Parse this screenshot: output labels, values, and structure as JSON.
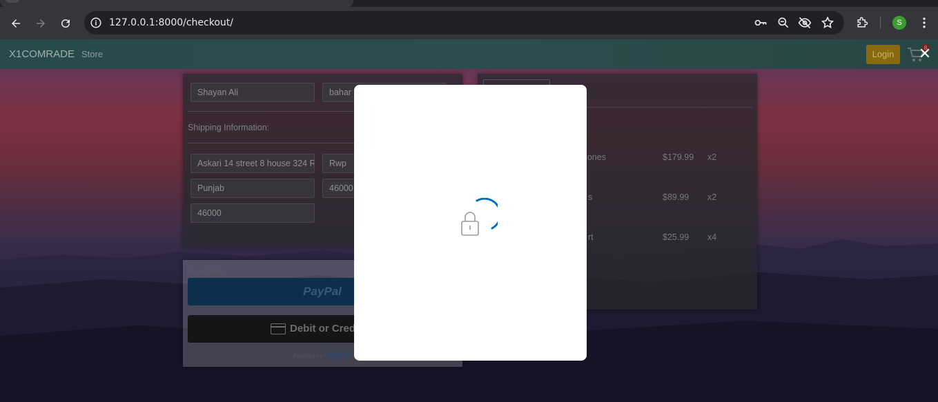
{
  "browser": {
    "url": "127.0.0.1:8000/checkout/",
    "profile_initial": "S",
    "icons": [
      "back-icon",
      "forward-icon",
      "reload-icon",
      "info-icon",
      "key-icon",
      "zoom-icon",
      "eye-off-icon",
      "star-icon",
      "extensions-icon",
      "menu-icon"
    ]
  },
  "navbar": {
    "brand": "X1COMRADE",
    "store_link": "Store",
    "login_label": "Login",
    "cart_count": "8",
    "close_symbol": "✕"
  },
  "form": {
    "name_value": "Shayan Ali",
    "email_value": "bahar",
    "shipping_label": "Shipping Information:",
    "address_value": "Askari 14 street 8 house 324 R",
    "city_value": "Rwp",
    "state_value": "Punjab",
    "zipcode_value": "46000",
    "country_value": "46000"
  },
  "payment": {
    "options_label": "Paypal Options",
    "paypal_label": "PayPal",
    "card_label": "Debit or Credit",
    "powered_prefix": "Powered by",
    "powered_brand": "PayPal"
  },
  "summary": {
    "items": [
      {
        "name": "dphones",
        "price": "$179.99",
        "qty": "x2"
      },
      {
        "name": "s",
        "price": "$89.99",
        "qty": "x2"
      },
      {
        "name": "rt",
        "price": "$25.99",
        "qty": "x4"
      }
    ]
  },
  "modal": {
    "state": "loading",
    "icons": [
      "lock-icon",
      "spinner-icon"
    ],
    "accent": "#0070ba"
  }
}
